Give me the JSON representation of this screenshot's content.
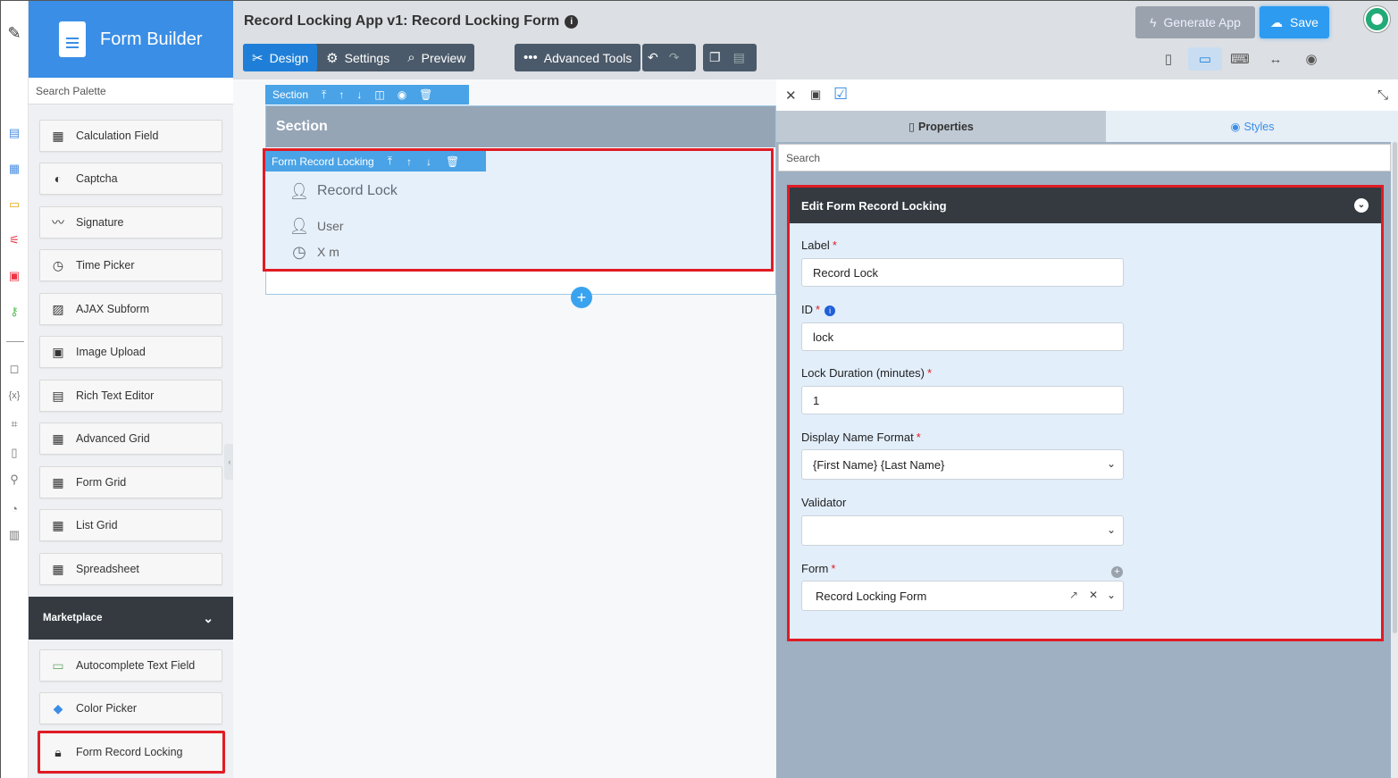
{
  "palette": {
    "header_title": "Form Builder",
    "search_placeholder": "Search Palette",
    "items": [
      {
        "label": "Calculation Field",
        "icon": "calculator-icon"
      },
      {
        "label": "Captcha",
        "icon": "shield-icon"
      },
      {
        "label": "Signature",
        "icon": "signature-icon"
      },
      {
        "label": "Time Picker",
        "icon": "clock-icon"
      },
      {
        "label": "AJAX Subform",
        "icon": "subform-icon"
      },
      {
        "label": "Image Upload",
        "icon": "image-icon"
      },
      {
        "label": "Rich Text Editor",
        "icon": "rich-text-icon"
      },
      {
        "label": "Advanced Grid",
        "icon": "grid-icon"
      },
      {
        "label": "Form Grid",
        "icon": "grid-icon"
      },
      {
        "label": "List Grid",
        "icon": "grid-icon"
      },
      {
        "label": "Spreadsheet",
        "icon": "grid-icon"
      }
    ],
    "marketplace_label": "Marketplace",
    "marketplace_items": [
      {
        "label": "Autocomplete Text Field",
        "icon": "autocomplete-icon"
      },
      {
        "label": "Color Picker",
        "icon": "color-picker-icon"
      },
      {
        "label": "Form Record Locking",
        "icon": "lock-icon"
      }
    ]
  },
  "header": {
    "title": "Record Locking App v1: Record Locking Form",
    "tabs": [
      {
        "label": "Design",
        "active": true
      },
      {
        "label": "Settings",
        "active": false
      },
      {
        "label": "Preview",
        "active": false
      }
    ],
    "advanced_tools_label": "Advanced Tools",
    "generate_app_label": "Generate App",
    "save_label": "Save"
  },
  "canvas": {
    "section_toolbar_label": "Section",
    "section_title": "Section",
    "element_toolbar_label": "Form Record Locking",
    "element_title": "Record Lock",
    "element_user": "User",
    "element_minutes": "X m"
  },
  "properties": {
    "tab_properties": "Properties",
    "tab_styles": "Styles",
    "search_placeholder": "Search",
    "card_title": "Edit Form Record Locking",
    "fields": {
      "label": {
        "label": "Label",
        "value": "Record Lock"
      },
      "id": {
        "label": "ID",
        "value": "lock"
      },
      "lock_duration": {
        "label": "Lock Duration (minutes)",
        "value": "1"
      },
      "display_name_format": {
        "label": "Display Name Format",
        "value": "{First Name} {Last Name}"
      },
      "validator": {
        "label": "Validator",
        "value": ""
      },
      "form": {
        "label": "Form",
        "value": "Record Locking Form"
      }
    }
  },
  "colors": {
    "accent": "#3a8ee6",
    "highlight": "#e01b24",
    "dark": "#343a40"
  }
}
